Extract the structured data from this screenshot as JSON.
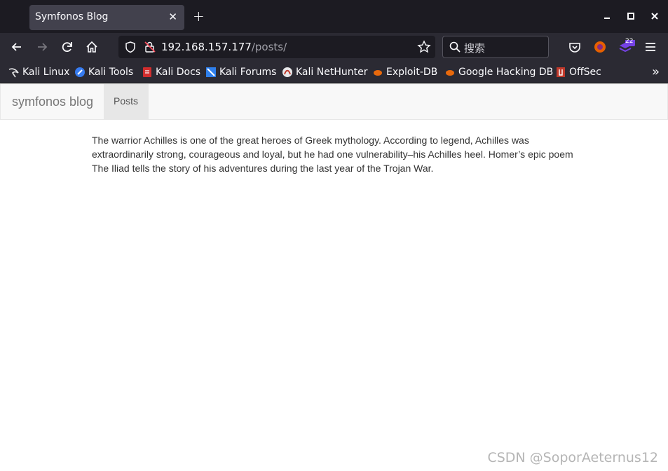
{
  "browser": {
    "tab_title": "Symfonos Blog",
    "url_host": "192.168.157.177",
    "url_path": "/posts/",
    "search_placeholder": "搜索",
    "extension_badge": "22"
  },
  "bookmarks": [
    {
      "label": "Kali Linux",
      "icon": "kali-dragon-icon"
    },
    {
      "label": "Kali Tools",
      "icon": "kali-tools-icon"
    },
    {
      "label": "Kali Docs",
      "icon": "kali-docs-icon"
    },
    {
      "label": "Kali Forums",
      "icon": "kali-forums-icon"
    },
    {
      "label": "Kali NetHunter",
      "icon": "nethunter-icon"
    },
    {
      "label": "Exploit-DB",
      "icon": "exploit-db-icon"
    },
    {
      "label": "Google Hacking DB",
      "icon": "ghdb-icon"
    },
    {
      "label": "OffSec",
      "icon": "offsec-icon"
    }
  ],
  "site": {
    "brand": "symfonos blog",
    "nav_active": "Posts",
    "post_text": "The warrior Achilles is one of the great heroes of Greek mythology. According to legend, Achilles was extraordinarily strong, courageous and loyal, but he had one vulnerability–his Achilles heel. Homer’s epic poem The Iliad tells the story of his adventures during the last year of the Trojan War."
  },
  "watermark": "CSDN @SoporAeternus12",
  "colors": {
    "chrome_dark": "#1c1b22",
    "toolbar": "#2b2a33",
    "navbar_bg": "#f8f8f8",
    "active_nav": "#e7e7e7"
  }
}
